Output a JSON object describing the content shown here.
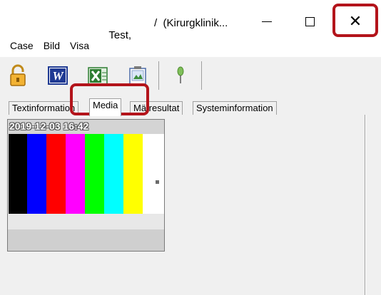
{
  "window": {
    "title_part1": "Test,",
    "title_part2": "/  (Kirurgklinik...",
    "minimize_glyph": "—",
    "close_glyph": "✕"
  },
  "menu": {
    "items": [
      {
        "label": "Case"
      },
      {
        "label": "Bild"
      },
      {
        "label": "Visa"
      }
    ]
  },
  "toolbar": {
    "buttons": [
      {
        "icon": "lock-icon"
      },
      {
        "icon": "word-icon"
      },
      {
        "icon": "excel-icon"
      },
      {
        "icon": "image-icon"
      },
      {
        "icon": "pin-icon"
      }
    ]
  },
  "tabs": [
    {
      "label": "Textinformation",
      "active": false
    },
    {
      "label": "Media",
      "active": true
    },
    {
      "label": "Mätresultat",
      "active": false
    },
    {
      "label": "Systeminformation",
      "active": false
    }
  ],
  "media": {
    "items": [
      {
        "timestamp": "2019-12-03 16:42",
        "bar_colors": [
          "#000000",
          "#0000ff",
          "#ff0000",
          "#ff00ff",
          "#00ff00",
          "#00ffff",
          "#ffff00",
          "#ffffff"
        ]
      }
    ]
  },
  "colors": {
    "highlight": "#b3141b",
    "toolbar_bg": "#f0f0f0"
  }
}
